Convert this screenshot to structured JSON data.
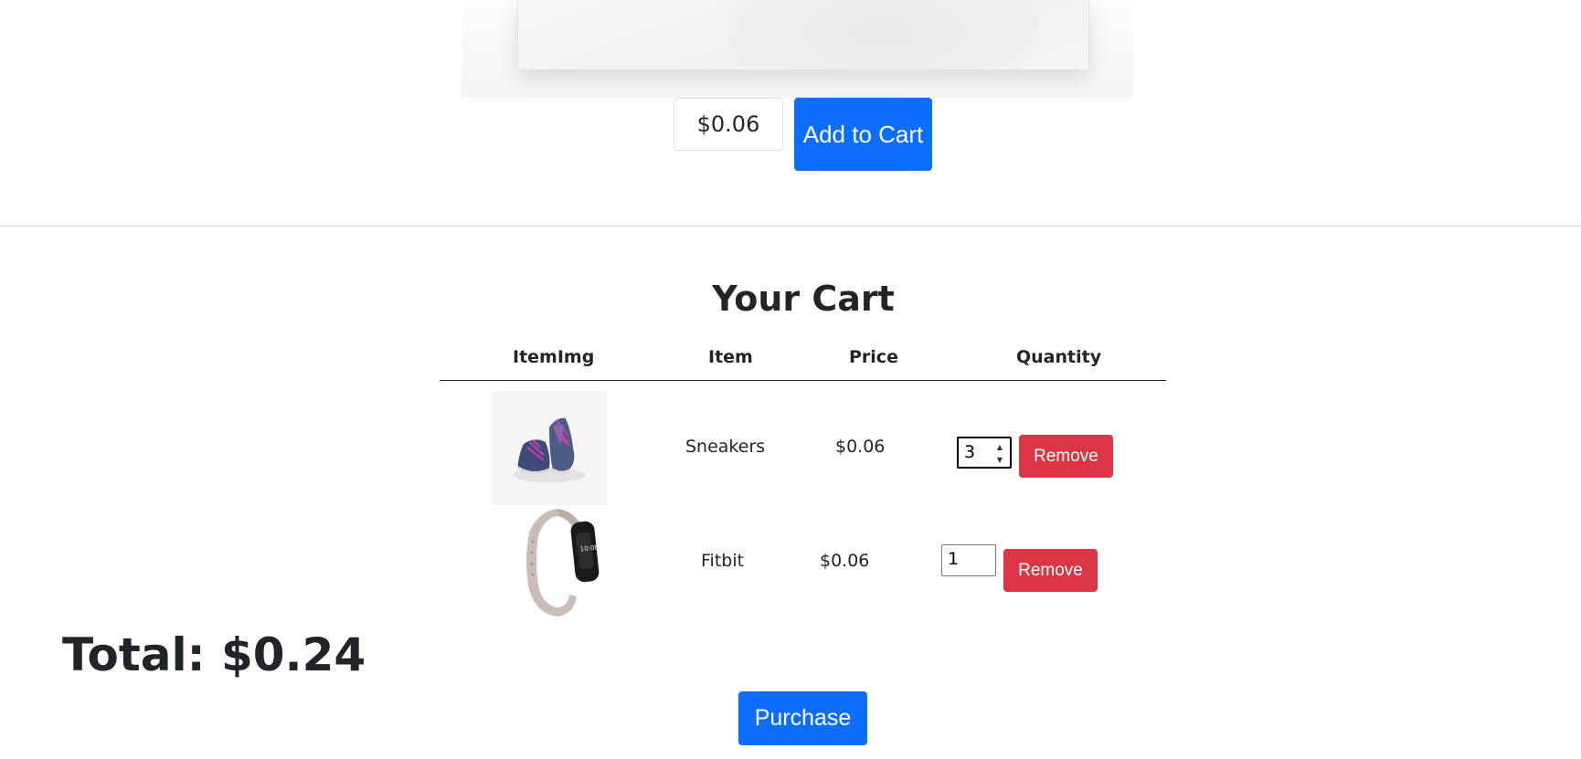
{
  "product": {
    "price": "$0.06",
    "add_to_cart_label": "Add to Cart"
  },
  "cart": {
    "title": "Your Cart",
    "headers": {
      "image": "ItemImg",
      "item": "Item",
      "price": "Price",
      "quantity": "Quantity"
    },
    "rows": [
      {
        "name": "Sneakers",
        "price": "$0.06",
        "quantity": "3",
        "remove_label": "Remove",
        "image": "sneakers-image"
      },
      {
        "name": "Fitbit",
        "price": "$0.06",
        "quantity": "1",
        "remove_label": "Remove",
        "image": "fitbit-image"
      }
    ]
  },
  "total": "Total: $0.24",
  "purchase_label": "Purchase",
  "colors": {
    "primary": "#0d6efd",
    "danger": "#dc3545",
    "text": "#212529"
  }
}
